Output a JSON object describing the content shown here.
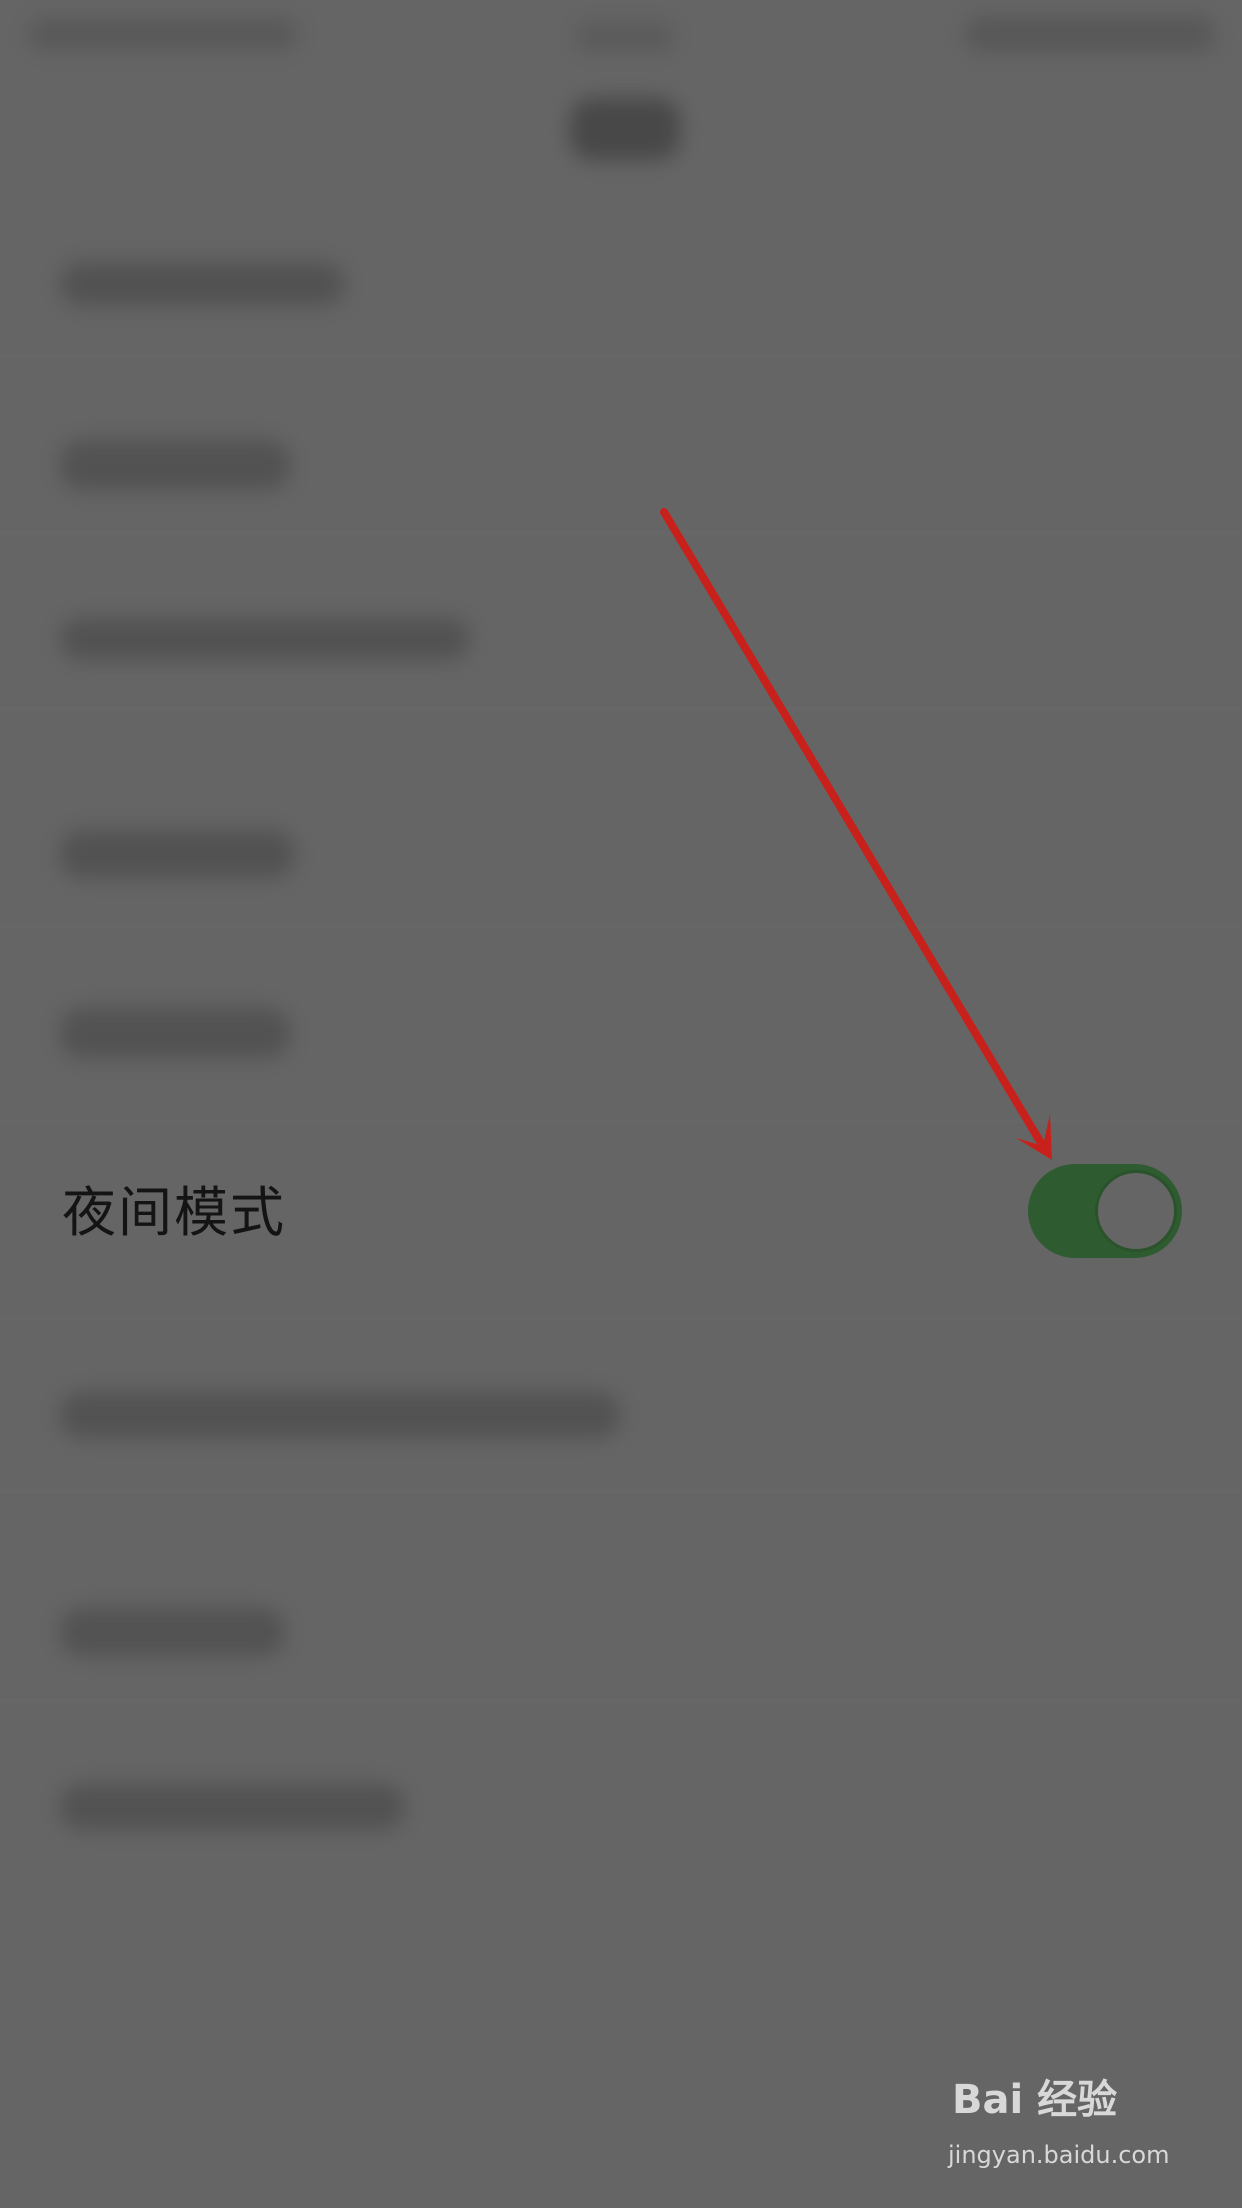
{
  "settings": {
    "night_mode": {
      "label": "夜间模式",
      "enabled": true
    }
  },
  "colors": {
    "background": "#656565",
    "toggle_on": "#2e5b2f",
    "annotation_arrow": "#c8211b"
  },
  "watermark": {
    "logo_text": "Bai 经验",
    "url": "jingyan.baidu.com"
  }
}
